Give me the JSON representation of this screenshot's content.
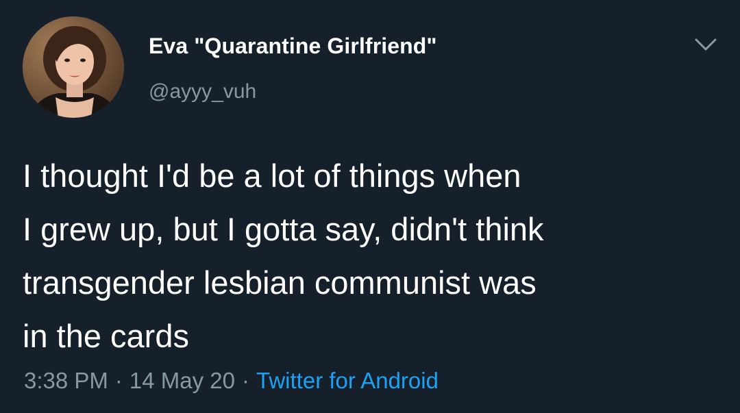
{
  "author": {
    "display_name": "Eva \"Quarantine Girlfriend\"",
    "handle": "@ayyy_vuh"
  },
  "tweet": {
    "lines": [
      "I thought I'd be a lot of things when",
      "I grew up, but I gotta say, didn't think",
      "transgender lesbian communist was",
      "in the cards"
    ]
  },
  "meta": {
    "time": "3:38 PM",
    "separator": "·",
    "date": "14 May 20",
    "source": "Twitter for Android"
  },
  "icons": {
    "menu": "chevron-down-icon"
  },
  "colors": {
    "background": "#15202b",
    "primary_text": "#ffffff",
    "secondary_text": "#8899a6",
    "link": "#1da1f2"
  }
}
